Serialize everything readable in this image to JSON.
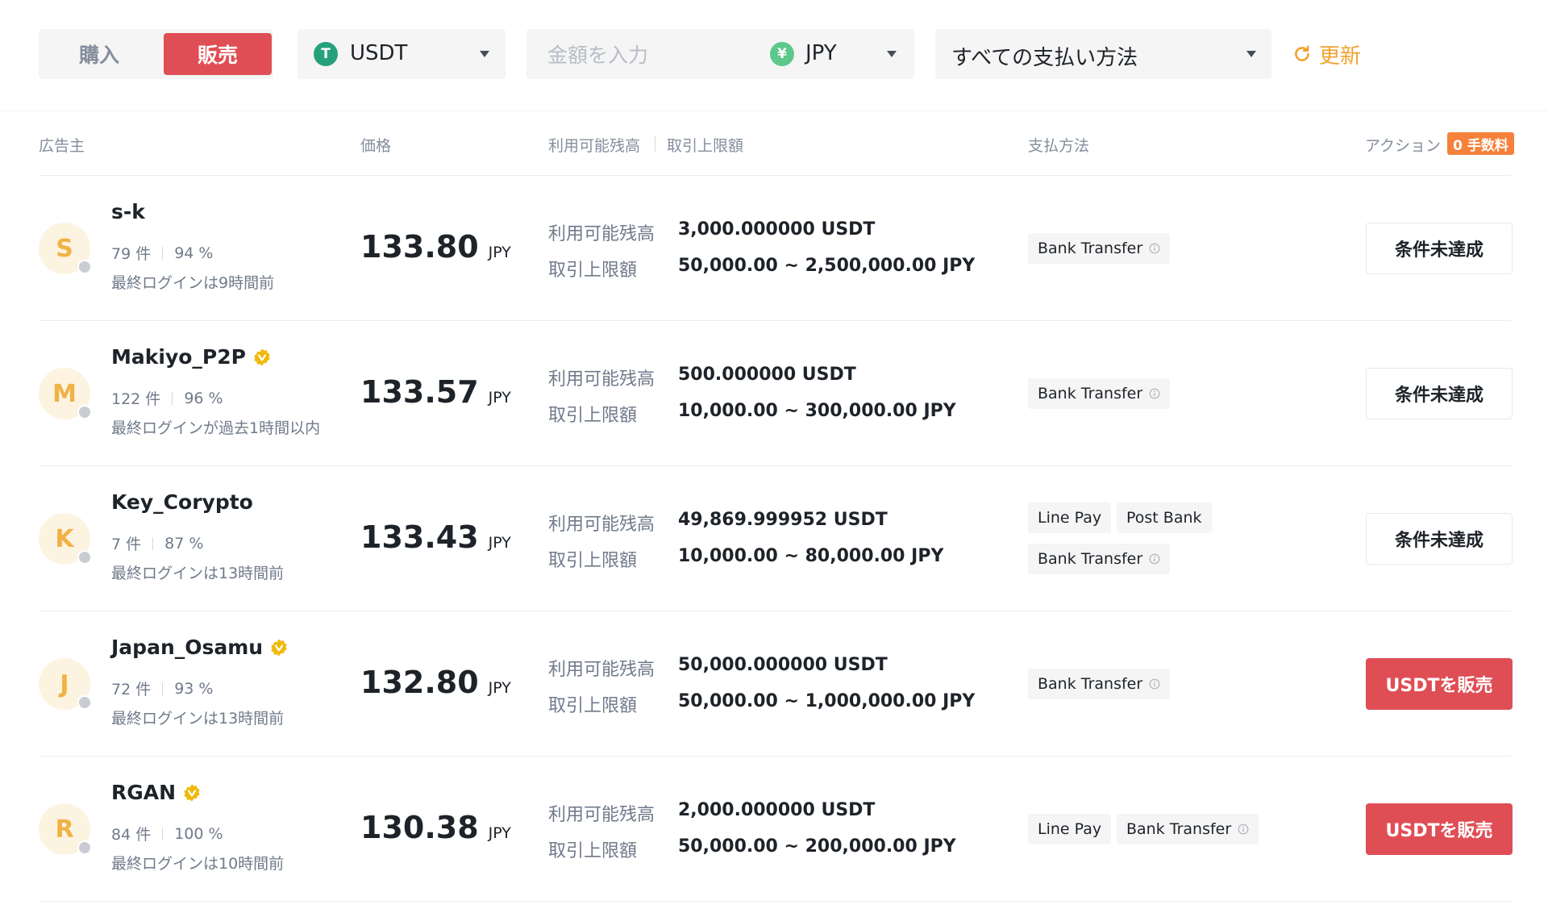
{
  "tabs": {
    "buy": "購入",
    "sell": "販売"
  },
  "coin_select": {
    "icon": "T",
    "value": "USDT",
    "icon_color": "#26a17b"
  },
  "amount": {
    "placeholder": "金額を入力"
  },
  "fiat_select": {
    "icon": "¥",
    "value": "JPY",
    "icon_color": "#5cc88b"
  },
  "payment_select": {
    "value": "すべての支払い方法"
  },
  "refresh": {
    "label": "更新"
  },
  "table_header": {
    "advertiser": "広告主",
    "price": "価格",
    "available": "利用可能残高",
    "limit": "取引上限額",
    "payment": "支払方法",
    "action": "アクション",
    "fee_badge": "0 手数料"
  },
  "labels": {
    "available": "利用可能残高",
    "limit": "取引上限額"
  },
  "colors": {
    "accent_red": "#e04e55",
    "accent_orange": "#f0a22e",
    "avatar_text": "#f0b245"
  },
  "rows": [
    {
      "initial": "S",
      "name": "s-k",
      "verified": false,
      "orders": "79 件",
      "completion": "94 %",
      "last_login": "最終ログインは9時間前",
      "price": "133.80",
      "unit": "JPY",
      "available": "3,000.000000 USDT",
      "limit": "50,000.00 ~ 2,500,000.00 JPY",
      "payments": [
        {
          "label": "Bank Transfer",
          "info": true
        }
      ],
      "action": "条件未達成",
      "action_type": "disabled"
    },
    {
      "initial": "M",
      "name": "Makiyo_P2P",
      "verified": true,
      "orders": "122 件",
      "completion": "96 %",
      "last_login": "最終ログインが過去1時間以内",
      "price": "133.57",
      "unit": "JPY",
      "available": "500.000000 USDT",
      "limit": "10,000.00 ~ 300,000.00 JPY",
      "payments": [
        {
          "label": "Bank Transfer",
          "info": true
        }
      ],
      "action": "条件未達成",
      "action_type": "disabled"
    },
    {
      "initial": "K",
      "name": "Key_Corypto",
      "verified": false,
      "orders": "7 件",
      "completion": "87 %",
      "last_login": "最終ログインは13時間前",
      "price": "133.43",
      "unit": "JPY",
      "available": "49,869.999952 USDT",
      "limit": "10,000.00 ~ 80,000.00 JPY",
      "payments": [
        {
          "label": "Line Pay",
          "info": false
        },
        {
          "label": "Post Bank",
          "info": false
        },
        {
          "label": "Bank Transfer",
          "info": true
        }
      ],
      "action": "条件未達成",
      "action_type": "disabled"
    },
    {
      "initial": "J",
      "name": "Japan_Osamu",
      "verified": true,
      "orders": "72 件",
      "completion": "93 %",
      "last_login": "最終ログインは13時間前",
      "price": "132.80",
      "unit": "JPY",
      "available": "50,000.000000 USDT",
      "limit": "50,000.00 ~ 1,000,000.00 JPY",
      "payments": [
        {
          "label": "Bank Transfer",
          "info": true
        }
      ],
      "action": "USDTを販売",
      "action_type": "sell"
    },
    {
      "initial": "R",
      "name": "RGAN",
      "verified": true,
      "orders": "84 件",
      "completion": "100 %",
      "last_login": "最終ログインは10時間前",
      "price": "130.38",
      "unit": "JPY",
      "available": "2,000.000000 USDT",
      "limit": "50,000.00 ~ 200,000.00 JPY",
      "payments": [
        {
          "label": "Line Pay",
          "info": false
        },
        {
          "label": "Bank Transfer",
          "info": true
        }
      ],
      "action": "USDTを販売",
      "action_type": "sell"
    }
  ]
}
